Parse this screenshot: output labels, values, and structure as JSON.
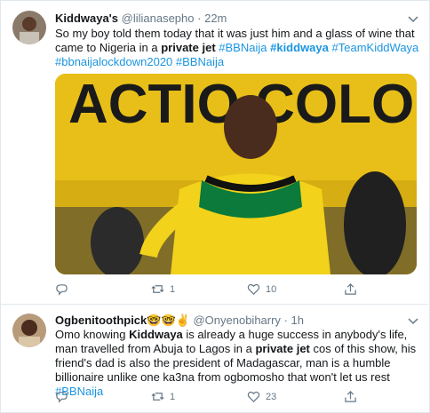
{
  "tweets": [
    {
      "name": "Kiddwaya's",
      "handle": "@lilianasepho",
      "sep": "·",
      "time": "22m",
      "text_parts": {
        "p1": "So my boy told them today that it was just him and a glass of wine that came to Nigeria in a ",
        "bold1": "private jet",
        "sp1": " ",
        "tag1": "#BBNaija",
        "sp2": " ",
        "tag2": "#kiddwaya",
        "sp3": " ",
        "tag3": "#TeamKiddWaya",
        "sp4": " ",
        "tag4": "#bbnaijalockdown2020",
        "sp5": " ",
        "tag5": "#BBNaija"
      },
      "media_text": "ACTIO COLO",
      "actions": {
        "reply": "",
        "retweet": "1",
        "like": "10"
      }
    },
    {
      "name": "Ogbenitoothpick🤓🤓✌️",
      "handle": "@Onyenobiharry",
      "sep": "·",
      "time": "1h",
      "text_parts": {
        "p1": "Omo knowing ",
        "bold1": "Kiddwaya",
        "p2": " is already a huge success in anybody's life, man travelled from Abuja to Lagos in a ",
        "bold2": "private jet",
        "p3": " cos of this show, his friend's dad is also the president of Madagascar, man is a humble billionaire unlike one ka3na from ogbomosho that won't let us rest ",
        "tag1": "#BBNaija"
      },
      "actions": {
        "reply": "",
        "retweet": "1",
        "like": "23"
      }
    }
  ],
  "colors": {
    "link": "#1b95e0",
    "muted": "#657786",
    "border": "#e1e8ed",
    "anc_yellow": "#f2c400",
    "anc_green": "#0b7a3a"
  },
  "icons": [
    "chevron-down-icon",
    "reply-icon",
    "retweet-icon",
    "like-icon",
    "share-icon"
  ]
}
